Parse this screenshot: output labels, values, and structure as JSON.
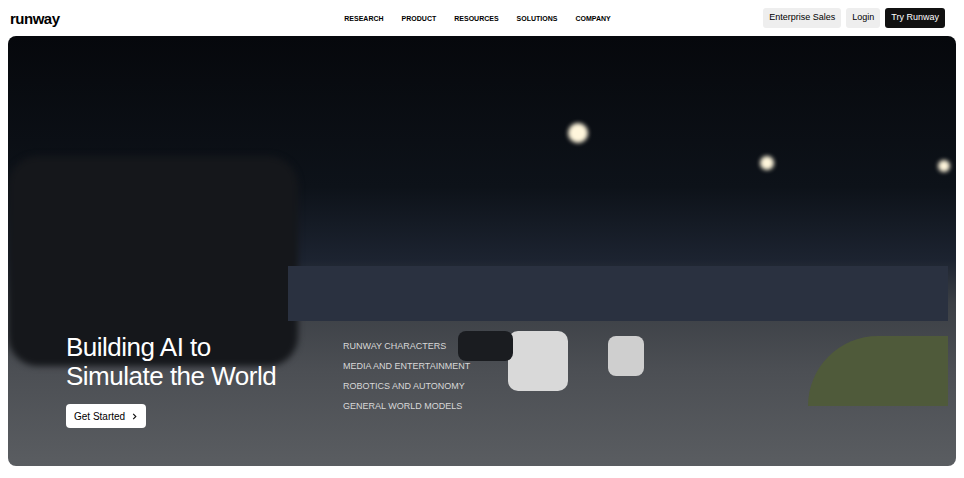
{
  "logo": "runway",
  "nav": [
    "RESEARCH",
    "PRODUCT",
    "RESOURCES",
    "SOLUTIONS",
    "COMPANY"
  ],
  "header_buttons": [
    {
      "label": "Enterprise Sales",
      "kind": "secondary"
    },
    {
      "label": "Login",
      "kind": "secondary"
    },
    {
      "label": "Try Runway",
      "kind": "primary"
    }
  ],
  "hero": {
    "headline": "Building AI to Simulate the World",
    "cta": "Get Started",
    "links": [
      "RUNWAY CHARACTERS",
      "MEDIA AND ENTERTAINMENT",
      "ROBOTICS AND AUTONOMY",
      "GENERAL WORLD MODELS"
    ]
  }
}
